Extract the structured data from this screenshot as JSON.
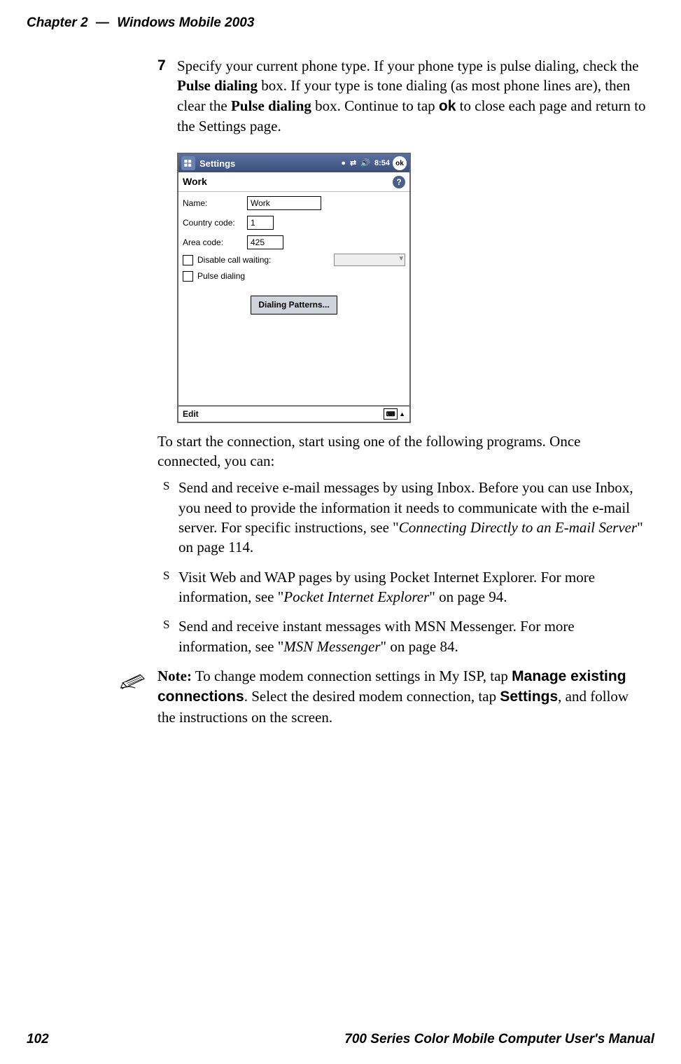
{
  "header": {
    "chapter": "Chapter 2",
    "dash": "—",
    "title": "Windows Mobile 2003"
  },
  "footer": {
    "page": "102",
    "manual": "700 Series Color Mobile Computer User's Manual"
  },
  "step7": {
    "num": "7",
    "t1": "Specify your current phone type. If your phone type is pulse dialing, check the ",
    "b1": "Pulse dialing",
    "t2": " box. If your type is tone dialing (as most phone lines are), then clear the ",
    "b2": "Pulse dialing",
    "t3": " box. Continue to tap ",
    "b3": "ok",
    "t4": " to close each page and return to the Settings page."
  },
  "screenshot": {
    "titlebar": {
      "title": "Settings",
      "time": "8:54",
      "ok": "ok"
    },
    "section": "Work",
    "name_label": "Name:",
    "name_value": "Work",
    "cc_label": "Country code:",
    "cc_value": "1",
    "ac_label": "Area code:",
    "ac_value": "425",
    "disable_cw": "Disable call waiting:",
    "pulse": "Pulse dialing",
    "button": "Dialing Patterns...",
    "edit": "Edit"
  },
  "after_ss": "To start the connection, start using one of the following programs. Once connected, you can:",
  "bullets": {
    "b1a": "Send and receive e-mail messages by using Inbox. Before you can use Inbox, you need to provide the information it needs to communicate with the e-mail server. For specific instructions, see \"",
    "b1i": "Connecting Directly to an E-mail Server",
    "b1b": "\" on page 114.",
    "b2a": "Visit Web and WAP pages by using Pocket Internet Explorer. For more information, see \"",
    "b2i": "Pocket Internet Explorer",
    "b2b": "\" on page 94.",
    "b3a": "Send and receive instant messages with MSN Messenger. For more information, see \"",
    "b3i": "MSN Messenger",
    "b3b": "\" on page 84."
  },
  "note": {
    "lead": "Note:",
    "t1": " To change modem connection settings in My ISP, tap ",
    "b1": "Manage existing connections",
    "t2": ". Select the desired modem connection, tap ",
    "b2": "Settings",
    "t3": ", and follow the instructions on the screen."
  }
}
